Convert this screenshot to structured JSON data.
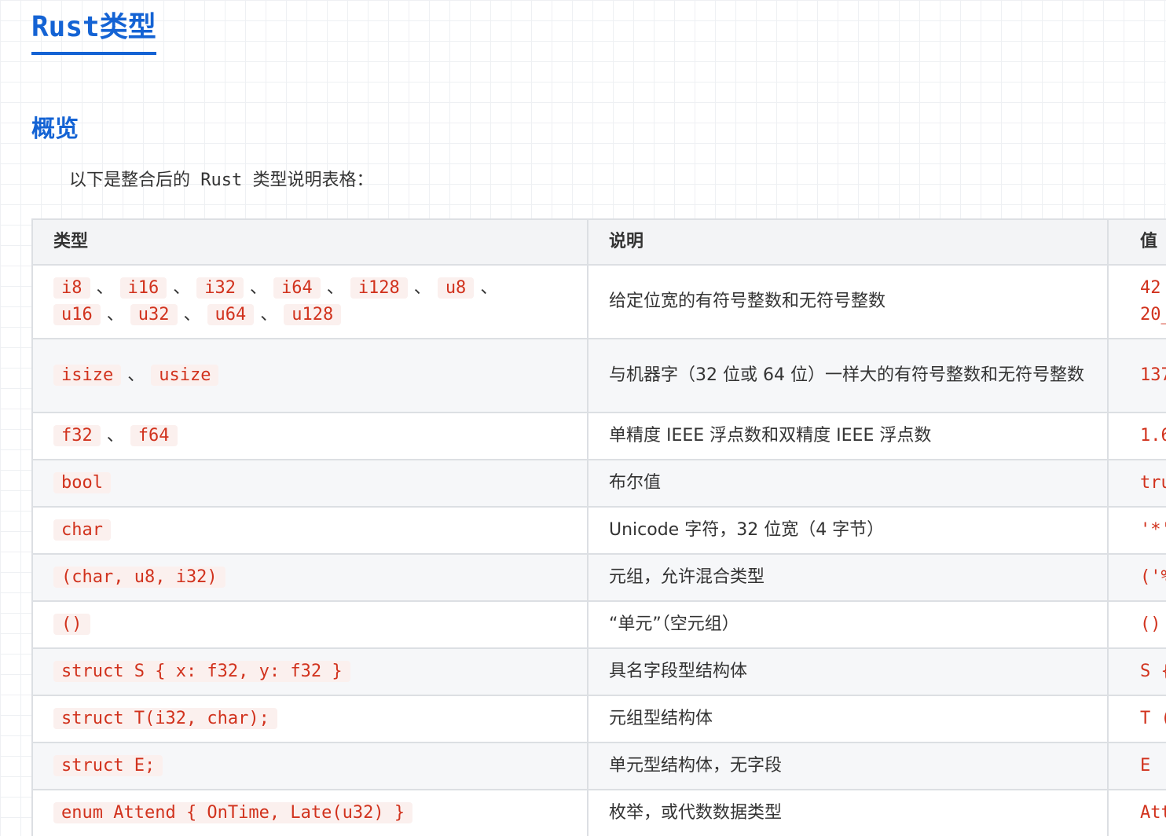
{
  "doc": {
    "title": "Rust类型",
    "section_title": "概览",
    "intro": "以下是整合后的 Rust 类型说明表格："
  },
  "table": {
    "headers": [
      "类型",
      "说明",
      "值"
    ],
    "rows": [
      {
        "types": [
          "i8",
          "i16",
          "i32",
          "i64",
          "i128",
          "u8",
          "u16",
          "u32",
          "u64",
          "u128"
        ],
        "description": "给定位宽的有符号整数和无符号整数",
        "value_lines": [
          "42",
          "20_"
        ]
      },
      {
        "types": [
          "isize",
          "usize"
        ],
        "description": "与机器字（32 位或 64 位）一样大的有符号整数和无符号整数",
        "value_lines": [
          "137"
        ]
      },
      {
        "types": [
          "f32",
          "f64"
        ],
        "description": "单精度 IEEE 浮点数和双精度 IEEE 浮点数",
        "value_lines": [
          "1.6"
        ]
      },
      {
        "types": [
          "bool"
        ],
        "description": "布尔值",
        "value_lines": [
          "tru"
        ]
      },
      {
        "types": [
          "char"
        ],
        "description": "Unicode 字符，32 位宽（4 字节）",
        "value_lines": [
          "'*'"
        ]
      },
      {
        "types": [
          "(char, u8, i32)"
        ],
        "description": "元组，允许混合类型",
        "value_lines": [
          "('%"
        ]
      },
      {
        "types": [
          "()"
        ],
        "description": "“单元”（空元组）",
        "value_lines": [
          "()"
        ]
      },
      {
        "types": [
          "struct S { x: f32, y: f32 }"
        ],
        "description": "具名字段型结构体",
        "value_lines": [
          "S {"
        ]
      },
      {
        "types": [
          "struct T(i32, char);"
        ],
        "description": "元组型结构体",
        "value_lines": [
          "T ("
        ]
      },
      {
        "types": [
          "struct E;"
        ],
        "description": "单元型结构体，无字段",
        "value_lines": [
          "E"
        ]
      },
      {
        "types": [
          "enum Attend { OnTime, Late(u32) }"
        ],
        "description": "枚举，或代数数据类型",
        "value_lines": [
          "Att"
        ]
      }
    ]
  },
  "colors": {
    "heading_blue": "#1463d4",
    "code_red": "#d1321d",
    "code_bg": "#fbf0ee",
    "table_border": "#dcdfe3"
  }
}
